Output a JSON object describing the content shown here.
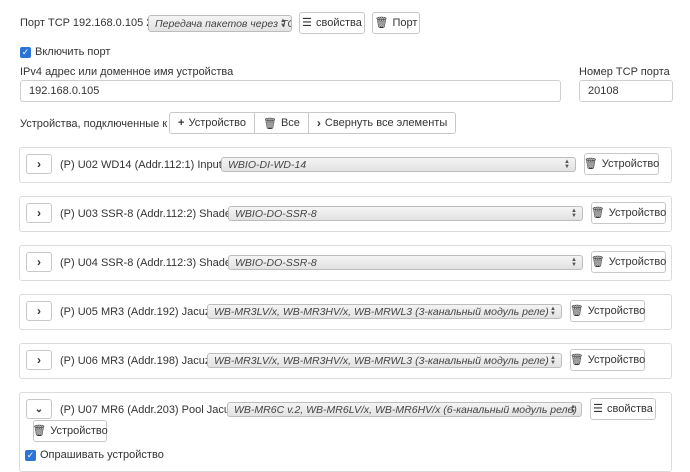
{
  "port": {
    "title": "Порт TCP 192.168.0.105 20108",
    "mode_select": "Передача пакетов через TCP",
    "properties_button": "свойства",
    "port_button": "Порт",
    "enable_label": "Включить порт",
    "address_label": "IPv4 адрес или доменное имя устройства",
    "address_value": "192.168.0.105",
    "tcp_port_label": "Номер TCP порта",
    "tcp_port_value": "20108",
    "devices_label": "Устройства, подключенные к порту",
    "add_device_button": "Устройство",
    "all_button": "Все",
    "collapse_all_button": "Свернуть все элементы"
  },
  "devices": [
    {
      "label": "(P) U02 WD14 (Addr.112:1) Inputs 112:1",
      "type": "WBIO-DI-WD-14",
      "delete_button": "Устройство",
      "expanded": false
    },
    {
      "label": "(P) U03 SSR-8 (Addr.112:2) Shades 112:2",
      "type": "WBIO-DO-SSR-8",
      "delete_button": "Устройство",
      "expanded": false
    },
    {
      "label": "(P) U04 SSR-8 (Addr.112:3) Shades 112:3",
      "type": "WBIO-DO-SSR-8",
      "delete_button": "Устройство",
      "expanded": false
    },
    {
      "label": "(P) U05 MR3 (Addr.192) Jacuzzi 192",
      "type": "WB-MR3LV/x, WB-MR3HV/x, WB-MRWL3 (3-канальный модуль реле)",
      "delete_button": "Устройство",
      "expanded": false
    },
    {
      "label": "(P) U06 MR3 (Addr.198) Jacuzzi 198",
      "type": "WB-MR3LV/x, WB-MR3HV/x, WB-MRWL3 (3-канальный модуль реле)",
      "delete_button": "Устройство",
      "expanded": false
    },
    {
      "label": "(P) U07 MR6 (Addr.203) Pool Jacuzzi 203",
      "type": "WB-MR6C v.2, WB-MR6LV/x, WB-MR6HV/x (6-канальный модуль реле)",
      "properties_button": "свойства",
      "delete_button": "Устройство",
      "poll_label": "Опрашивать устройство",
      "expanded": true
    }
  ],
  "colors": {
    "accent": "#2a74d8",
    "border": "#dcdcdc"
  },
  "icons": [
    "list-icon",
    "trash-icon",
    "plus-icon",
    "chevron-right-icon",
    "chevron-down-icon",
    "checkbox-checked-icon"
  ]
}
